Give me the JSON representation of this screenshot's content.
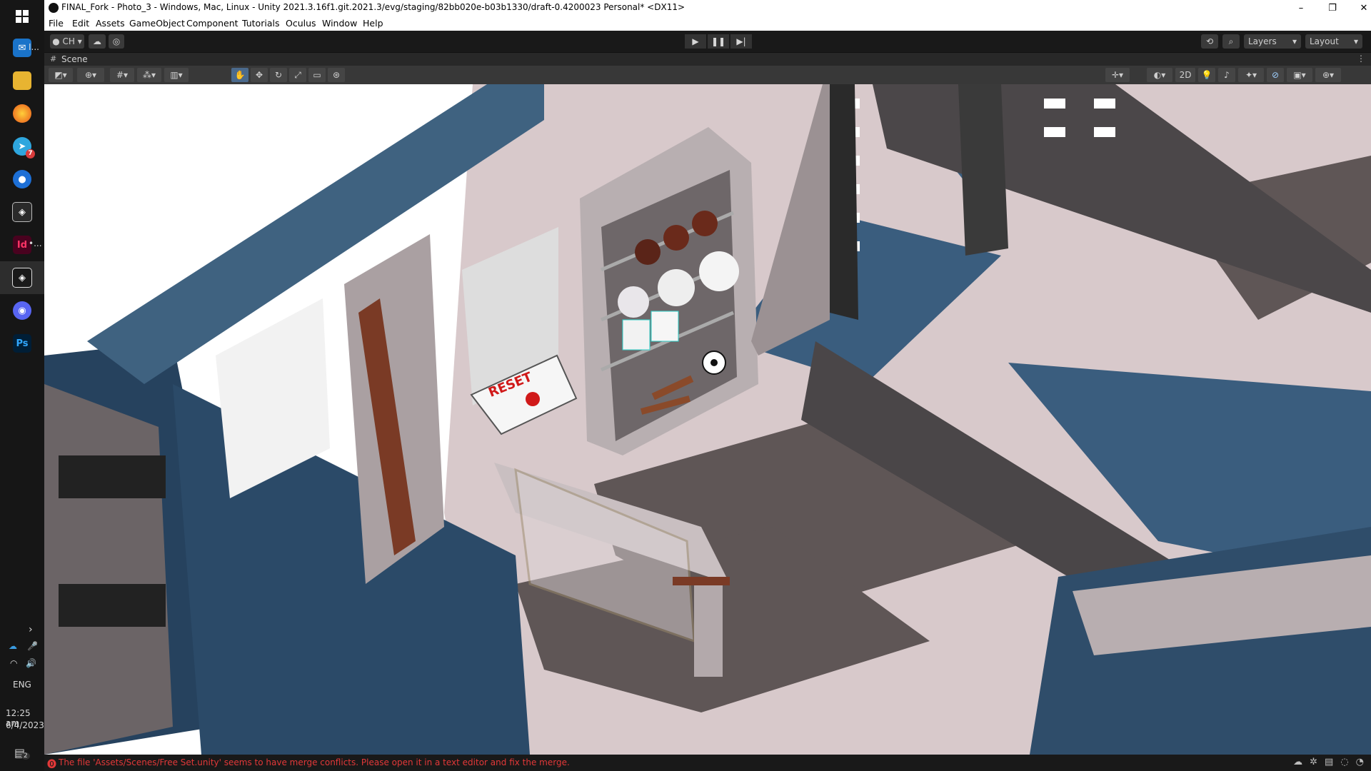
{
  "window": {
    "title": "FINAL_Fork - Photo_3 - Windows, Mac, Linux - Unity 2021.3.16f1.git.2021.3/evg/staging/82bb020e-b03b1330/draft-0.4200023 Personal* <DX11>",
    "minimize": "–",
    "restore": "❐",
    "close": "✕"
  },
  "menu": [
    "File",
    "Edit",
    "Assets",
    "GameObject",
    "Component",
    "Tutorials",
    "Oculus",
    "Window",
    "Help"
  ],
  "toolbar": {
    "account_label": "CH",
    "play_icon": "▶",
    "pause_icon": "❚❚",
    "step_icon": "▶|",
    "layers_label": "Layers",
    "layout_label": "Layout"
  },
  "scene_tab": {
    "label": "Scene"
  },
  "scene_toolbar": {
    "twod_label": "2D"
  },
  "scene": {
    "reset_label": "RESET"
  },
  "taskbar": {
    "app_labels": [
      "Id",
      "Ps"
    ],
    "mail_badge": "I...",
    "indesign_more": "•...",
    "language": "ENG",
    "time": "12:25 am",
    "date": "6/4/2023",
    "notification_count": "2",
    "telegram_badge": "7"
  },
  "status": {
    "message": "The file 'Assets/Scenes/Free Set.unity' seems to have merge conflicts. Please open it in a text editor and fix the merge."
  },
  "colors": {
    "status_error": "#e23838",
    "taskbar_bg": "#161616",
    "toolbar_bg": "#191919",
    "accent_blue": "#3a8fd8"
  }
}
